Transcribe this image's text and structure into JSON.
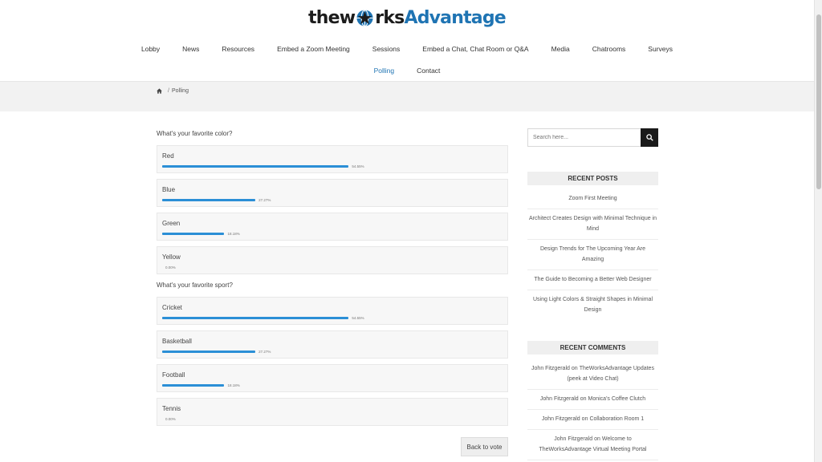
{
  "brand": {
    "logo_part1": "thew",
    "logo_part2": "rks",
    "logo_part3": "Advantage"
  },
  "nav": {
    "row1": [
      "Lobby",
      "News",
      "Resources",
      "Embed a Zoom Meeting",
      "Sessions",
      "Embed a Chat, Chat Room or Q&A",
      "Media",
      "Chatrooms",
      "Surveys"
    ],
    "row2": [
      "Polling",
      "Contact"
    ],
    "active": "Polling"
  },
  "breadcrumb": {
    "current": "Polling",
    "separator": "/"
  },
  "polls": [
    {
      "question": "What's your favorite color?",
      "options": [
        {
          "label": "Red",
          "percent_text": "54.55%",
          "percent": 54.55
        },
        {
          "label": "Blue",
          "percent_text": "27.27%",
          "percent": 27.27
        },
        {
          "label": "Green",
          "percent_text": "18.18%",
          "percent": 18.18
        },
        {
          "label": "Yellow",
          "percent_text": "0.00%",
          "percent": 0
        }
      ]
    },
    {
      "question": "What's your favorite sport?",
      "options": [
        {
          "label": "Cricket",
          "percent_text": "54.55%",
          "percent": 54.55
        },
        {
          "label": "Basketball",
          "percent_text": "27.27%",
          "percent": 27.27
        },
        {
          "label": "Football",
          "percent_text": "18.18%",
          "percent": 18.18
        },
        {
          "label": "Tennis",
          "percent_text": "0.00%",
          "percent": 0
        }
      ]
    }
  ],
  "back_button": "Back to vote",
  "sidebar": {
    "search_placeholder": "Search here...",
    "recent_posts_title": "RECENT POSTS",
    "recent_posts": [
      "Zoom First Meeting",
      "Architect Creates Design with Minimal Technique in Mind",
      "Design Trends for The Upcoming Year Are Amazing",
      "The Guide to Becoming a Better Web Designer",
      "Using Light Colors & Straight Shapes in Minimal Design"
    ],
    "recent_comments_title": "RECENT COMMENTS",
    "recent_comments": [
      {
        "author": "John Fitzgerald",
        "on": "on",
        "post": "TheWorksAdvantage Updates (peek at Video Chat)"
      },
      {
        "author": "John Fitzgerald",
        "on": "on",
        "post": "Monica's Coffee Clutch"
      },
      {
        "author": "John Fitzgerald",
        "on": "on",
        "post": "Collaboration Room 1"
      },
      {
        "author": "John Fitzgerald",
        "on": "on",
        "post": "Welcome to TheWorksAdvantage Virtual Meeting Portal"
      }
    ]
  },
  "colors": {
    "accent": "#1f74b3",
    "bar": "#2b8fd6",
    "search_button": "#1a1a1a"
  },
  "icons": {
    "home": "home-icon",
    "search": "search-icon",
    "logo_globe": "globe-icon"
  }
}
